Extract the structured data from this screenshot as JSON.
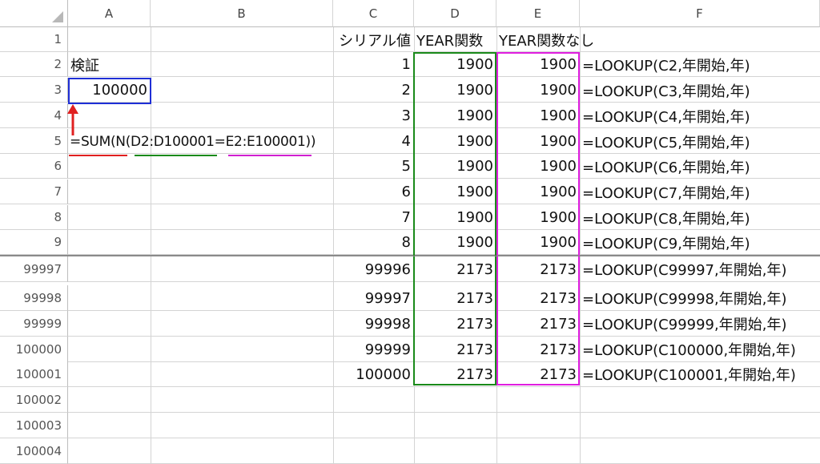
{
  "columns": [
    "A",
    "B",
    "C",
    "D",
    "E",
    "F"
  ],
  "rows": [
    {
      "num": "1",
      "c": "シリアル値",
      "d": "YEAR関数",
      "e": "YEAR関数なし",
      "f": ""
    },
    {
      "num": "2",
      "a": "検証",
      "c": "1",
      "d": "1900",
      "e": "1900",
      "f": "=LOOKUP(C2,年開始,年)"
    },
    {
      "num": "3",
      "a": "100000",
      "c": "2",
      "d": "1900",
      "e": "1900",
      "f": "=LOOKUP(C3,年開始,年)"
    },
    {
      "num": "4",
      "c": "3",
      "d": "1900",
      "e": "1900",
      "f": "=LOOKUP(C4,年開始,年)"
    },
    {
      "num": "5",
      "c": "4",
      "d": "1900",
      "e": "1900",
      "f": "=LOOKUP(C5,年開始,年)"
    },
    {
      "num": "6",
      "c": "5",
      "d": "1900",
      "e": "1900",
      "f": "=LOOKUP(C6,年開始,年)"
    },
    {
      "num": "7",
      "c": "6",
      "d": "1900",
      "e": "1900",
      "f": "=LOOKUP(C7,年開始,年)"
    },
    {
      "num": "8",
      "c": "7",
      "d": "1900",
      "e": "1900",
      "f": "=LOOKUP(C8,年開始,年)"
    },
    {
      "num": "9",
      "c": "8",
      "d": "1900",
      "e": "1900",
      "f": "=LOOKUP(C9,年開始,年)"
    },
    {
      "num": "99997",
      "c": "99996",
      "d": "2173",
      "e": "2173",
      "f": "=LOOKUP(C99997,年開始,年)"
    },
    {
      "num": "99998",
      "c": "99997",
      "d": "2173",
      "e": "2173",
      "f": "=LOOKUP(C99998,年開始,年)"
    },
    {
      "num": "99999",
      "c": "99998",
      "d": "2173",
      "e": "2173",
      "f": "=LOOKUP(C99999,年開始,年)"
    },
    {
      "num": "100000",
      "c": "99999",
      "d": "2173",
      "e": "2173",
      "f": "=LOOKUP(C100000,年開始,年)"
    },
    {
      "num": "100001",
      "c": "100000",
      "d": "2173",
      "e": "2173",
      "f": "=LOOKUP(C100001,年開始,年)"
    },
    {
      "num": "100002"
    },
    {
      "num": "100003"
    },
    {
      "num": "100004"
    }
  ],
  "annotation": {
    "formula_parts": [
      "=SUM(N(",
      "D2:D100001",
      "=",
      "E2:E100001",
      "))"
    ],
    "arrow_icon": "arrow-up-icon"
  },
  "colors": {
    "blue_box": "#1f2fd6",
    "green_box": "#1a8a1a",
    "magenta_box": "#e01ee0",
    "red": "#e02020",
    "green_underline": "#1a8a1a",
    "magenta_underline": "#d020d0"
  }
}
